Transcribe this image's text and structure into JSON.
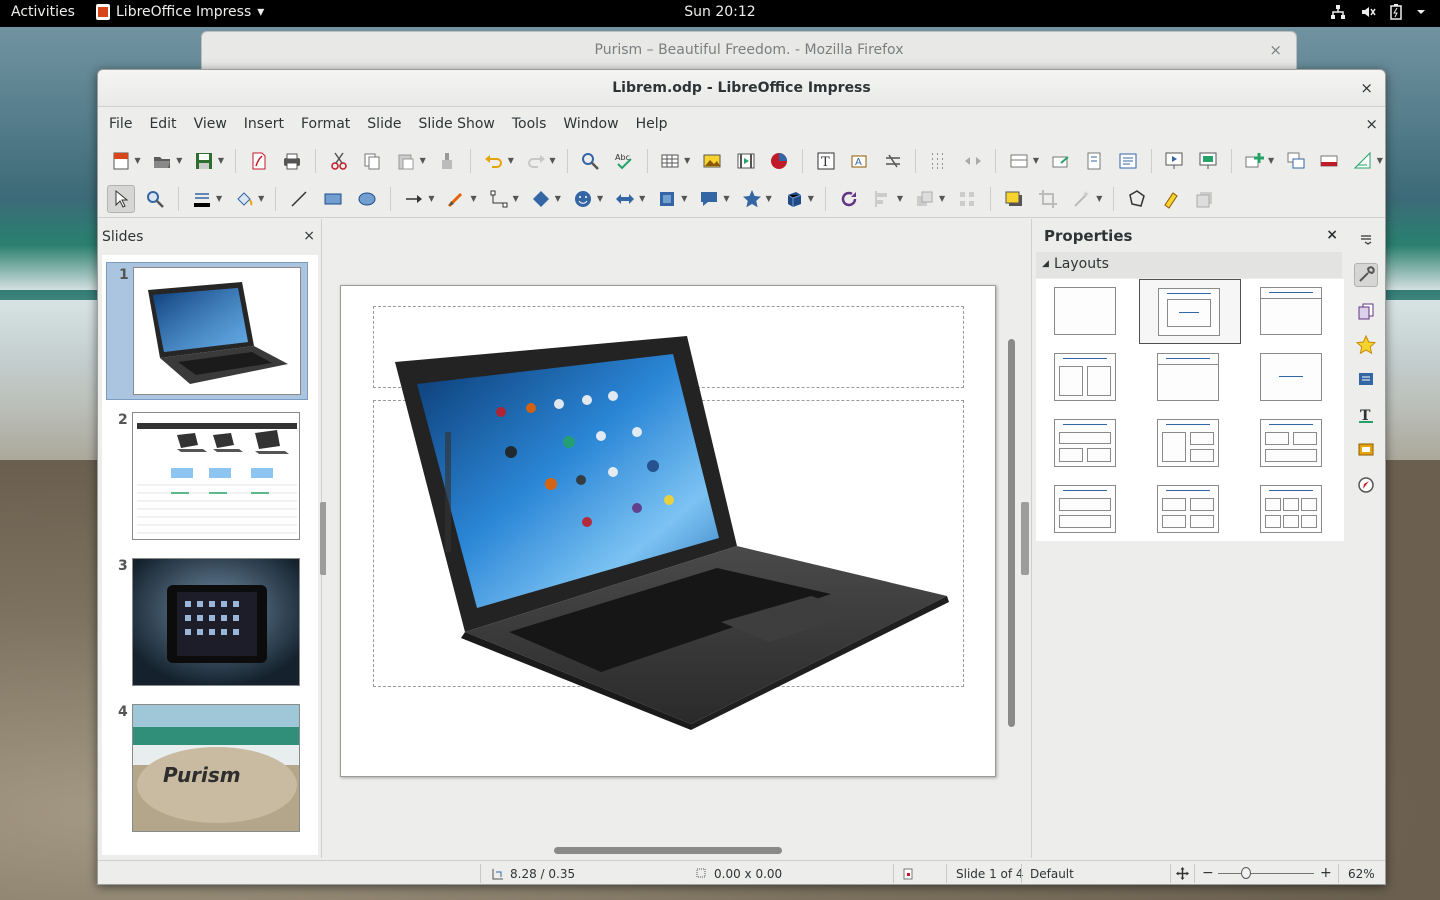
{
  "topbar": {
    "activities": "Activities",
    "app_name": "LibreOffice Impress",
    "app_menu_arrow": "▾",
    "clock": "Sun 20:12",
    "tray_icons": [
      "network-icon",
      "volume-icon",
      "power-icon"
    ]
  },
  "firefox": {
    "title": "Purism – Beautiful Freedom. - Mozilla Firefox",
    "close": "×"
  },
  "window": {
    "title": "Librem.odp - LibreOffice Impress",
    "close": "×",
    "doc_close": "×"
  },
  "menu": [
    "File",
    "Edit",
    "View",
    "Insert",
    "Format",
    "Slide",
    "Slide Show",
    "Tools",
    "Window",
    "Help"
  ],
  "slides_pane": {
    "title": "Slides",
    "close": "×",
    "slides": [
      {
        "number": "1",
        "selected": true
      },
      {
        "number": "2",
        "selected": false
      },
      {
        "number": "3",
        "selected": false
      },
      {
        "number": "4",
        "selected": false
      }
    ],
    "slide4_text": "Purism"
  },
  "properties": {
    "title": "Properties",
    "close": "×",
    "section": "Layouts",
    "selected_layout_index": 1,
    "layout_count": 12
  },
  "status": {
    "position": "8.28 / 0.35",
    "size": "0.00 x 0.00",
    "slide": "Slide 1 of 4",
    "master": "Default",
    "zoom_minus": "−",
    "zoom_plus": "+",
    "zoom": "62%"
  },
  "colors": {
    "accent_selected": "#abc4df",
    "window_bg": "#ededeb"
  }
}
